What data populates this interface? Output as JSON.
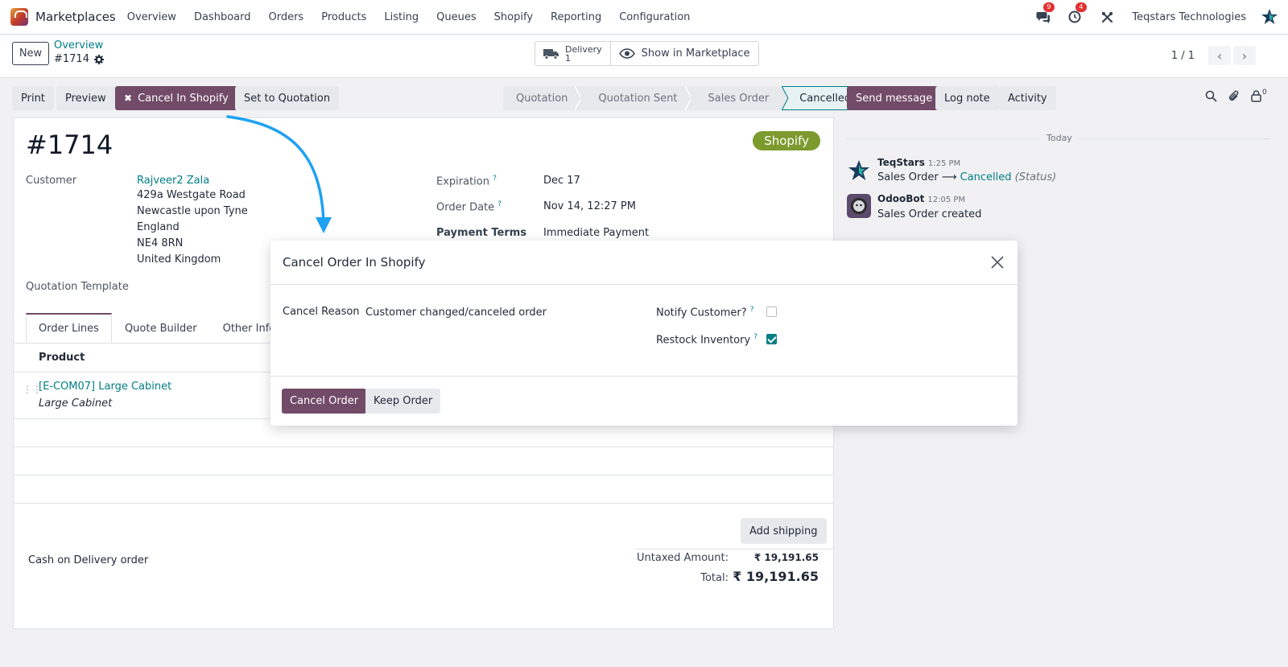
{
  "nav": {
    "app_name": "Marketplaces",
    "menu": [
      "Overview",
      "Dashboard",
      "Orders",
      "Products",
      "Listing",
      "Queues",
      "Shopify",
      "Reporting",
      "Configuration"
    ],
    "messages_count": "9",
    "activities_count": "4",
    "company": "Teqstars Technologies"
  },
  "control": {
    "new_label": "New",
    "breadcrumb_parent": "Overview",
    "breadcrumb_current": "#1714",
    "delivery_label": "Delivery",
    "delivery_count": "1",
    "show_marketplace": "Show in Marketplace",
    "pager": "1 / 1"
  },
  "actions": {
    "print": "Print",
    "preview": "Preview",
    "cancel_shopify": "Cancel In Shopify",
    "set_quotation": "Set to Quotation"
  },
  "status": {
    "stages": [
      "Quotation",
      "Quotation Sent",
      "Sales Order",
      "Cancelled"
    ],
    "active": "Cancelled"
  },
  "chatter_actions": {
    "send_message": "Send message",
    "log_note": "Log note",
    "activity": "Activity",
    "followers_count": "0"
  },
  "form": {
    "order_name": "#1714",
    "badge": "Shopify",
    "customer_label": "Customer",
    "customer_name": "Rajveer2 Zala",
    "address": [
      "429a Westgate Road",
      "Newcastle upon Tyne",
      "England",
      "NE4 8RN",
      "United Kingdom"
    ],
    "expiration_label": "Expiration",
    "expiration": "Dec 17",
    "order_date_label": "Order Date",
    "order_date": "Nov 14, 12:27 PM",
    "payment_terms_label": "Payment Terms",
    "payment_terms": "Immediate Payment",
    "quotation_template_label": "Quotation Template",
    "tabs": [
      "Order Lines",
      "Quote Builder",
      "Other Info"
    ],
    "col_product": "Product",
    "line_product": "[E-COM07] Large Cabinet",
    "line_description": "Large Cabinet",
    "add_shipping": "Add shipping",
    "note": "Cash on Delivery order",
    "untaxed_label": "Untaxed Amount:",
    "untaxed_value": "₹ 19,191.65",
    "total_label": "Total:",
    "total_value": "₹ 19,191.65"
  },
  "chatter": {
    "today": "Today",
    "messages": [
      {
        "author": "TeqStars",
        "time": "1:25 PM",
        "from": "Sales Order",
        "arrow": "⟶",
        "to": "Cancelled",
        "field": "(Status)"
      },
      {
        "author": "OdooBot",
        "time": "12:05 PM",
        "body": "Sales Order created"
      }
    ]
  },
  "dialog": {
    "title": "Cancel Order In Shopify",
    "cancel_reason_label": "Cancel Reason",
    "cancel_reason_value": "Customer changed/canceled order",
    "notify_label": "Notify Customer?",
    "notify_checked": false,
    "restock_label": "Restock Inventory",
    "restock_checked": true,
    "help_mark": "?",
    "cancel_button": "Cancel Order",
    "keep_button": "Keep Order"
  },
  "colors": {
    "brand": "#714b67",
    "accent": "#017e84",
    "badge": "#7c9a2d",
    "arrow": "#1ea1f2"
  }
}
